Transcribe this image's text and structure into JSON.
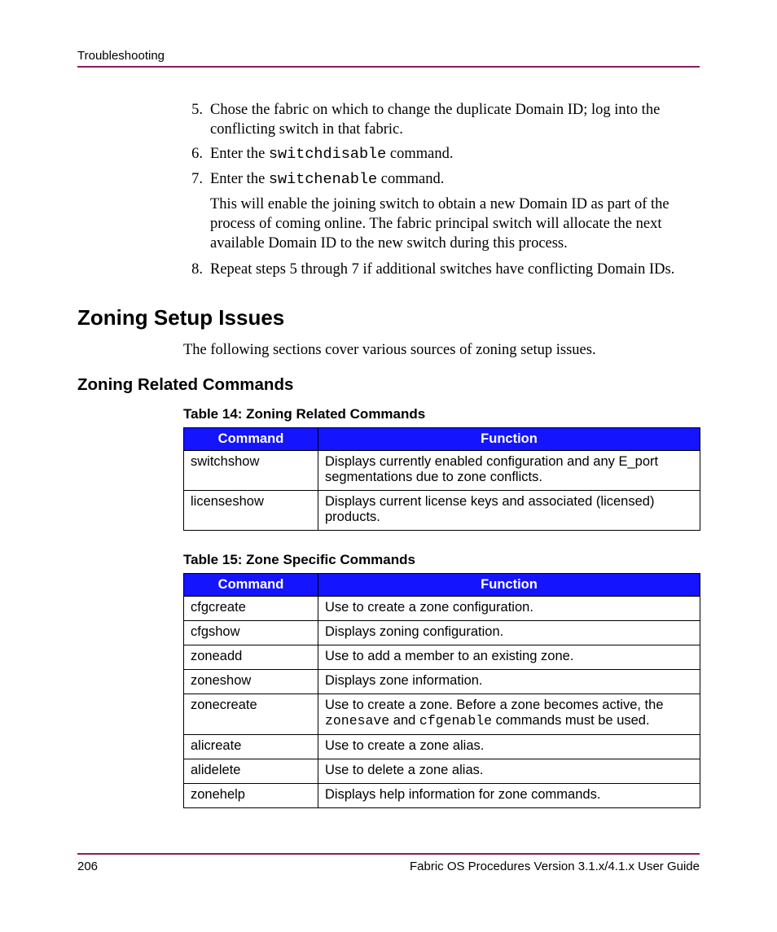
{
  "header": {
    "section": "Troubleshooting"
  },
  "steps": {
    "s5": {
      "num": "5.",
      "text": "Chose the fabric on which to change the duplicate Domain ID; log into the conflicting switch in that fabric."
    },
    "s6": {
      "num": "6.",
      "pre": "Enter the ",
      "cmd": "switchdisable",
      "post": " command."
    },
    "s7": {
      "num": "7.",
      "pre": "Enter the ",
      "cmd": "switchenable",
      "post": " command.",
      "follow": "This will enable the joining switch to obtain a new Domain ID as part of the process of coming online. The fabric principal switch will allocate the next available Domain ID to the new switch during this process."
    },
    "s8": {
      "num": "8.",
      "text": "Repeat steps 5 through 7 if additional switches have conflicting Domain IDs."
    }
  },
  "section": {
    "title": "Zoning Setup Issues",
    "intro": "The following sections cover various sources of zoning setup issues."
  },
  "subsection": {
    "title": "Zoning Related Commands"
  },
  "table14": {
    "caption": "Table 14:  Zoning Related Commands",
    "headers": {
      "cmd": "Command",
      "func": "Function"
    },
    "rows": [
      {
        "cmd": "switchshow",
        "func": "Displays currently enabled configuration and any E_port segmentations due to zone conflicts."
      },
      {
        "cmd": "licenseshow",
        "func": "Displays current license keys and associated (licensed) products."
      }
    ]
  },
  "table15": {
    "caption": "Table 15:  Zone Specific Commands",
    "headers": {
      "cmd": "Command",
      "func": "Function"
    },
    "rows": [
      {
        "cmd": "cfgcreate",
        "func": "Use to create a zone configuration."
      },
      {
        "cmd": "cfgshow",
        "func": "Displays zoning configuration."
      },
      {
        "cmd": "zoneadd",
        "func": "Use to add a member to an existing zone."
      },
      {
        "cmd": "zoneshow",
        "func": "Displays zone information."
      },
      {
        "cmd": "zonecreate",
        "func_pre": "Use to create a zone. Before a zone becomes active, the ",
        "func_cmd1": "zonesave",
        "func_mid": " and ",
        "func_cmd2": "cfgenable",
        "func_post": " commands must be used."
      },
      {
        "cmd": "alicreate",
        "func": "Use to create a zone alias."
      },
      {
        "cmd": "alidelete",
        "func": "Use to delete a zone alias."
      },
      {
        "cmd": "zonehelp",
        "func": "Displays help information for zone commands."
      }
    ]
  },
  "footer": {
    "page": "206",
    "doc": "Fabric OS Procedures Version 3.1.x/4.1.x User Guide"
  }
}
